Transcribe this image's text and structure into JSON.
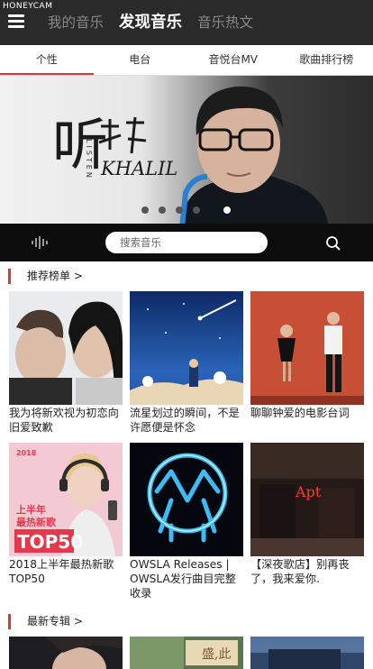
{
  "watermark": "HONEYCAM",
  "header": {
    "menu_icon": "hamburger-menu-icon",
    "nav": [
      "我的音乐",
      "发现音乐",
      "音乐热文"
    ],
    "active_index": 1,
    "background": "#2a2a2a"
  },
  "tabs": {
    "items": [
      "个性",
      "电台",
      "音悦台MV",
      "歌曲排行榜"
    ],
    "active_index": 0,
    "accent": "#d33a31"
  },
  "banner": {
    "art_text_main": "听",
    "art_text_vertical": "LISTEN",
    "art_text_name": "KHALIL",
    "slide_count": 5,
    "active_slide": 4
  },
  "search": {
    "placeholder": "搜索音乐",
    "left_icon": "sound-wave-icon",
    "right_icon": "search-icon"
  },
  "recommended": {
    "title": "推荐榜单 >",
    "items": [
      {
        "title": "我为将新欢视为初恋向旧爱致歉"
      },
      {
        "title": "流星划过的瞬间，不是许愿便是怀念"
      },
      {
        "title": "聊聊钟爱的电影台词"
      },
      {
        "title": "2018上半年最热新歌TOP50",
        "art_text": [
          "2018",
          "上半年",
          "最热新歌",
          "TOP50"
        ]
      },
      {
        "title": "OWSLA Releases | OWSLA发行曲目完整收录"
      },
      {
        "title": "【深夜歌店】别再丧了，我来爱你.",
        "art_text": "Apt"
      }
    ]
  },
  "new_albums": {
    "title": "最新专辑 >",
    "art_text": "盛,此"
  }
}
